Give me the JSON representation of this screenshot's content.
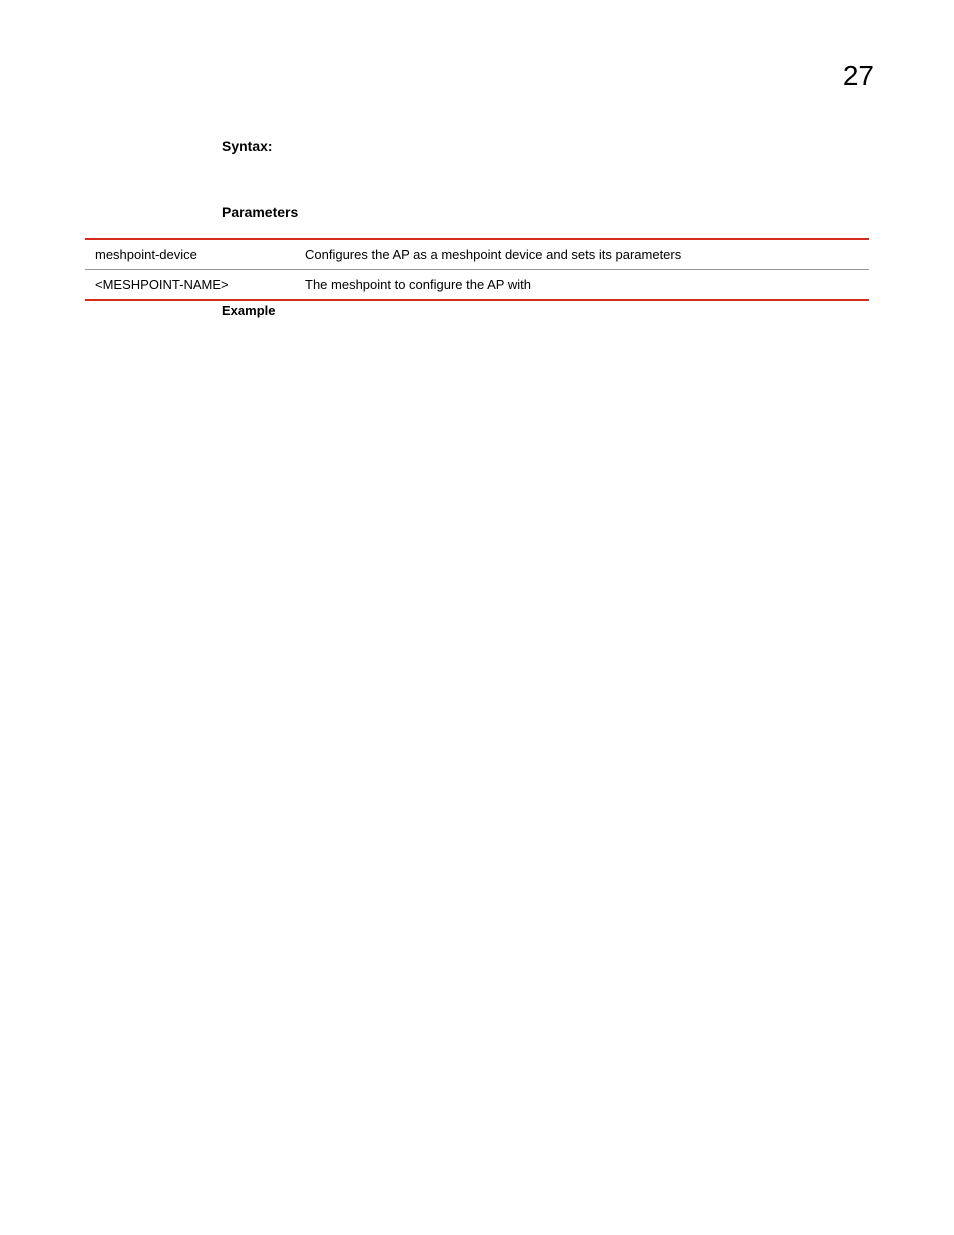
{
  "pageNumber": "27",
  "syntaxHeading": "Syntax:",
  "parametersHeading": "Parameters",
  "paramRows": [
    {
      "name": "meshpoint-device",
      "desc": "Configures the AP as a meshpoint device and sets its parameters"
    },
    {
      "name": "<MESHPOINT-NAME>",
      "desc": "The meshpoint to configure the AP with"
    }
  ],
  "exampleHeading": "Example"
}
